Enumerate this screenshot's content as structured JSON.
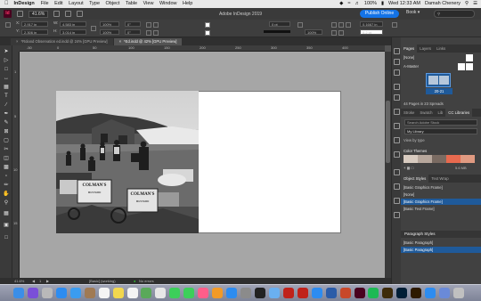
{
  "menubar": {
    "app": "InDesign",
    "items": [
      "File",
      "Edit",
      "Layout",
      "Type",
      "Object",
      "Table",
      "View",
      "Window",
      "Help"
    ],
    "battery": "100%",
    "clock": "Wed 12:33 AM",
    "user": "Damah Chenery"
  },
  "appbar": {
    "window_title": "Adobe InDesign 2019",
    "zoom": "41.6%",
    "publish_label": "Publish Online",
    "book_label": "Book",
    "search_placeholder": ""
  },
  "control": {
    "x_value": "2.917 in",
    "y_value": "2.306 in",
    "w_value": "4.583 in",
    "h_value": "3.014 in",
    "scale_w": "100%",
    "scale_h": "100%",
    "angle": "0°",
    "shear": "0°",
    "stroke": "0 pt",
    "opacity": "100%",
    "width_field": "0.1667 in",
    "fitting": "0.2 pt"
  },
  "tabs": [
    {
      "label": "*Roland Observation ed.indd @ 24% [GPU Preview]",
      "active": false
    },
    {
      "label": "*Ed.indd @ 42% [GPU Preview]",
      "active": true
    }
  ],
  "ruler": {
    "h_ticks": [
      "-50",
      "0",
      "50",
      "100",
      "150",
      "200",
      "250",
      "300",
      "350",
      "400"
    ],
    "v_ticks": [
      "1",
      "5",
      "10",
      "15"
    ]
  },
  "photo": {
    "sign1": "COLMAN'S",
    "sign2": "COLMAN'S",
    "sign_sub": "MUSTARD"
  },
  "statusbar": {
    "zoom": "41.6%",
    "page": "1",
    "preflight": "[Basic] (working)",
    "errors": "No errors"
  },
  "panels": {
    "pages_tabs": [
      "Pages",
      "Layers",
      "Links"
    ],
    "none_label": "[None]",
    "master_label": "A-Master",
    "spread_label": "20-21",
    "pages_summary": "44 Pages in 23 Spreads",
    "lib_tabs": [
      "Stroke",
      "Swatch",
      "Lib",
      "CC Libraries"
    ],
    "lib_search": "Search Adobe Stock",
    "lib_name": "My Library",
    "view_by": "View by type",
    "color_themes": "Color Themes",
    "theme_size": "5.6 MB",
    "theme_colors": [
      "#d8cbc0",
      "#b7a79c",
      "#7a6b62",
      "#e86a4f",
      "#e09a81"
    ],
    "object_styles_tabs": [
      "Object Styles",
      "Text Wrap"
    ],
    "object_styles": [
      "[Basic Graphics Frame]",
      "[None]",
      "[Basic Graphics Frame]",
      "[Basic Text Frame]"
    ],
    "object_selected": 2,
    "paragraph_title": "Paragraph Styles",
    "paragraph_styles": [
      "[Basic Paragraph]",
      "[Basic Paragraph]"
    ],
    "paragraph_selected": 1
  },
  "dock": {
    "icons": [
      "finder-icon",
      "siri-icon",
      "launchpad-icon",
      "safari-icon",
      "mail-icon",
      "contacts-icon",
      "calendar-icon",
      "notes-icon",
      "reminders-icon",
      "maps-icon",
      "photos-icon",
      "messages-icon",
      "facetime-icon",
      "itunes-icon",
      "ibooks-icon",
      "appstore-icon",
      "system-preferences-icon",
      "terminal-icon",
      "preview-icon",
      "acrobat-icon",
      "acrobat-dc-icon",
      "zoom-icon",
      "word-icon",
      "powerpoint-icon",
      "indesign-icon",
      "spotify-icon",
      "bridge-icon",
      "photoshop-icon",
      "illustrator-icon",
      "keynote-icon",
      "downloads-icon",
      "trash-icon"
    ]
  }
}
